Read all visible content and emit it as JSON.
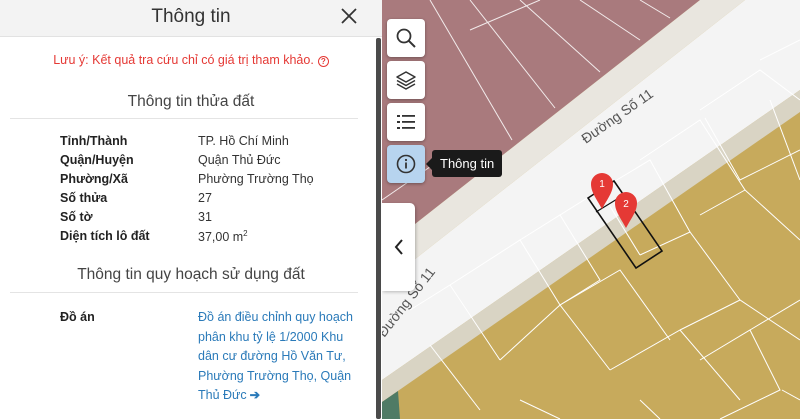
{
  "panel": {
    "title": "Thông tin",
    "notice": "Lưu ý: Kết quả tra cứu chỉ có giá trị tham khảo.",
    "land_section": {
      "title": "Thông tin thửa đất",
      "rows": [
        {
          "label": "Tỉnh/Thành",
          "value": "TP. Hồ Chí Minh"
        },
        {
          "label": "Quận/Huyện",
          "value": "Quận Thủ Đức"
        },
        {
          "label": "Phường/Xã",
          "value": "Phường Trường Thọ"
        },
        {
          "label": "Số thửa",
          "value": "27"
        },
        {
          "label": "Số tờ",
          "value": "31"
        },
        {
          "label": "Diện tích lô đất",
          "value": "37,00 m",
          "value_sup": "2"
        }
      ]
    },
    "plan_section": {
      "title": "Thông tin quy hoạch sử dụng đất",
      "label": "Đồ án",
      "value": "Đồ án điều chỉnh quy hoạch phân khu tỷ lệ 1/2000 Khu dân cư đường Hồ Văn Tư, Phường Trường Thọ, Quận Thủ Đức",
      "arrow": "➔"
    }
  },
  "map": {
    "street_label_1": "Đường Số 11",
    "street_label_2": "Đường Số 11",
    "marker_1": "1",
    "marker_2": "2",
    "tooltip": "Thông tin",
    "colors": {
      "residential_pink": "#a97a7d",
      "residential_gold": "#c7aa5c",
      "road": "#f3f3f3",
      "lot_line": "#ffffff",
      "marker": "#e53935"
    }
  },
  "tools": [
    "search-icon",
    "layers-icon",
    "list-icon",
    "info-icon"
  ],
  "icons": {
    "close": "close-icon",
    "collapse": "chevron-left-icon"
  }
}
